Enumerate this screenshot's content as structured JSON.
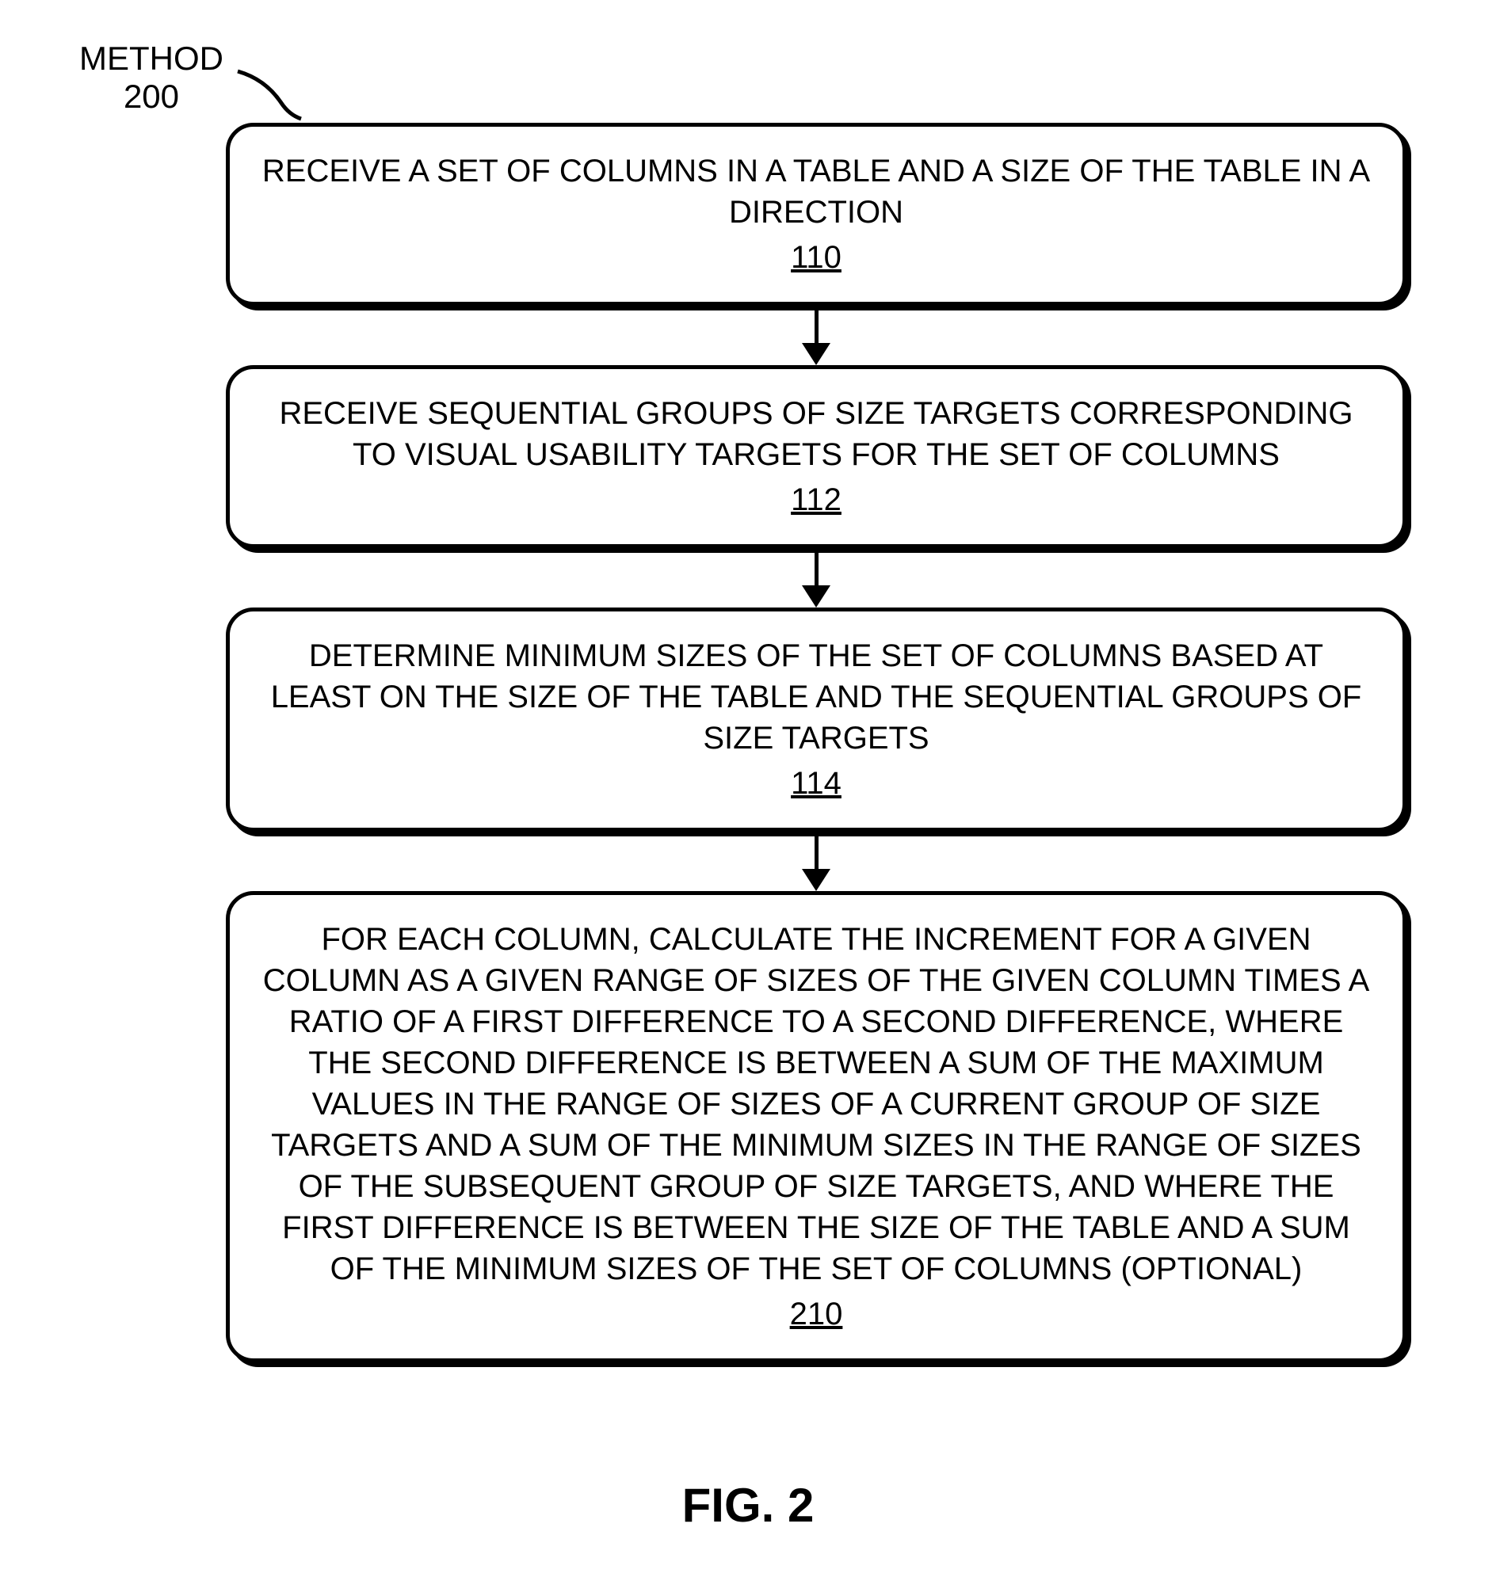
{
  "method_label": {
    "title": "METHOD",
    "number": "200"
  },
  "steps": [
    {
      "text": "RECEIVE A SET OF COLUMNS IN A TABLE AND A SIZE OF THE TABLE IN A DIRECTION",
      "number": "110"
    },
    {
      "text": "RECEIVE SEQUENTIAL GROUPS OF SIZE TARGETS CORRESPONDING TO VISUAL USABILITY TARGETS FOR THE SET OF COLUMNS",
      "number": "112"
    },
    {
      "text": "DETERMINE MINIMUM SIZES OF THE SET OF COLUMNS BASED AT LEAST ON THE SIZE OF THE TABLE AND THE SEQUENTIAL GROUPS OF SIZE TARGETS",
      "number": "114"
    },
    {
      "text": "FOR EACH COLUMN, CALCULATE THE INCREMENT FOR A GIVEN COLUMN AS A GIVEN RANGE OF SIZES OF THE GIVEN COLUMN TIMES A RATIO OF A FIRST DIFFERENCE TO A SECOND DIFFERENCE, WHERE THE SECOND DIFFERENCE IS BETWEEN A SUM OF THE MAXIMUM VALUES IN THE RANGE OF SIZES OF A CURRENT GROUP OF SIZE TARGETS AND A SUM OF THE MINIMUM SIZES IN THE RANGE OF SIZES OF THE SUBSEQUENT GROUP OF SIZE TARGETS, AND WHERE THE FIRST DIFFERENCE IS BETWEEN THE SIZE OF THE TABLE AND A SUM OF THE MINIMUM SIZES OF THE SET OF COLUMNS (OPTIONAL)",
      "number": "210"
    }
  ],
  "figure_label": "FIG. 2"
}
